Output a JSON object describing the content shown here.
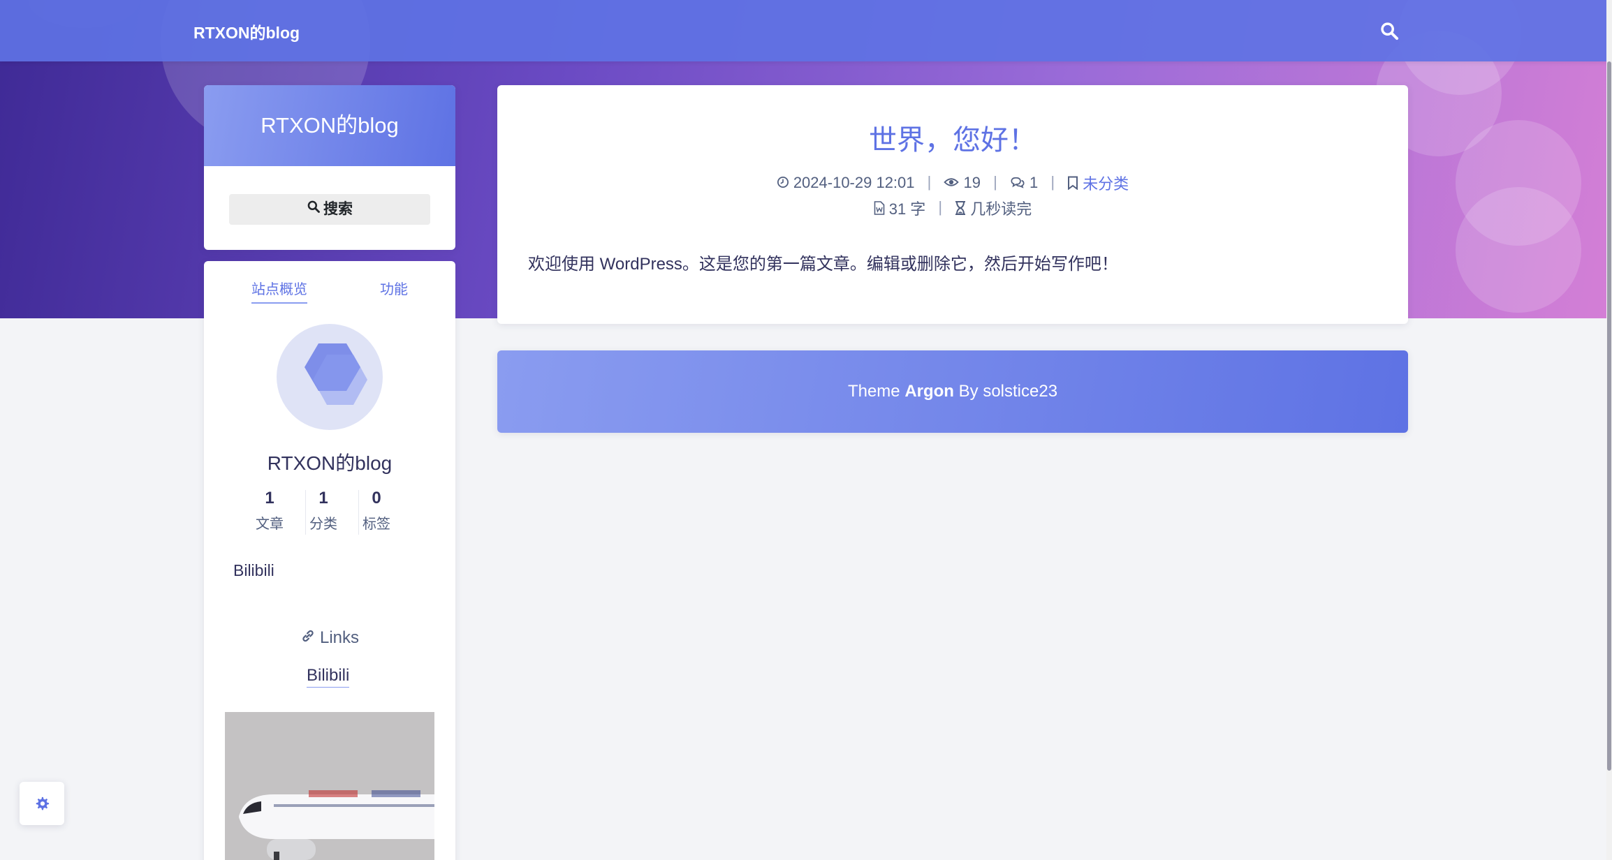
{
  "navbar": {
    "brand": "RTXON的blog"
  },
  "sidebar": {
    "site_title": "RTXON的blog",
    "search_label": "搜索",
    "tabs": [
      {
        "label": "站点概览",
        "active": true
      },
      {
        "label": "功能",
        "active": false
      }
    ],
    "profile_name": "RTXON的blog",
    "stats": [
      {
        "value": "1",
        "label": "文章"
      },
      {
        "value": "1",
        "label": "分类"
      },
      {
        "value": "0",
        "label": "标签"
      }
    ],
    "bilibili_text": "Bilibili",
    "links_heading": "Links",
    "links": [
      "Bilibili"
    ]
  },
  "post": {
    "title": "世界，您好！",
    "date": "2024-10-29 12:01",
    "views": "19",
    "comments": "1",
    "category": "未分类",
    "word_count": "31 字",
    "read_time": "几秒读完",
    "body": "欢迎使用 WordPress。这是您的第一篇文章。编辑或删除它，然后开始写作吧！"
  },
  "footer": {
    "prefix": "Theme ",
    "theme": "Argon",
    "suffix": " By solstice23"
  },
  "colors": {
    "accent": "#5e72e4",
    "text": "#32325d",
    "muted": "#525f7f"
  },
  "icons": {
    "nav_search": "search-icon",
    "sidebar_search": "search-icon",
    "date": "clock-icon",
    "views": "eye-icon",
    "comments": "comments-icon",
    "category": "bookmark-icon",
    "words": "file-word-icon",
    "read_time": "hourglass-icon",
    "links": "link-icon",
    "settings": "gear-icon"
  }
}
